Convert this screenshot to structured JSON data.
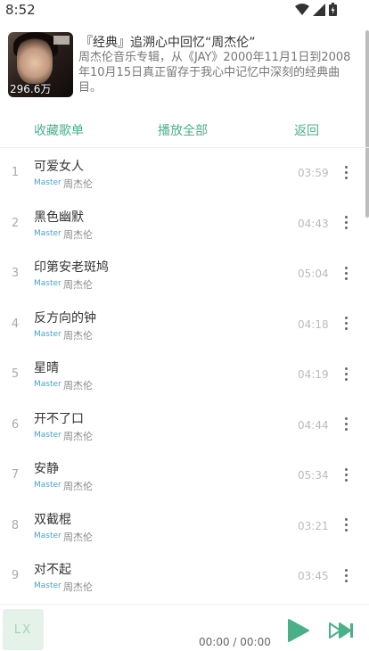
{
  "status_bar": {
    "time": "8:52"
  },
  "header": {
    "title": "『经典』追溯心中回忆“周杰伦”",
    "description": "周杰伦音乐专辑，从《JAY》2000年11月1日到2008年10月15日真正留存于我心中记忆中深刻的经典曲目。",
    "play_count": "296.6万"
  },
  "actions": {
    "favorite": "收藏歌单",
    "play_all": "播放全部",
    "back": "返回"
  },
  "songs": [
    {
      "index": "1",
      "name": "可爱女人",
      "quality": "Master",
      "artist": "周杰伦",
      "duration": "03:59"
    },
    {
      "index": "2",
      "name": "黑色幽默",
      "quality": "Master",
      "artist": "周杰伦",
      "duration": "04:43"
    },
    {
      "index": "3",
      "name": "印第安老斑鸠",
      "quality": "Master",
      "artist": "周杰伦",
      "duration": "05:04"
    },
    {
      "index": "4",
      "name": "反方向的钟",
      "quality": "Master",
      "artist": "周杰伦",
      "duration": "04:18"
    },
    {
      "index": "5",
      "name": "星晴",
      "quality": "Master",
      "artist": "周杰伦",
      "duration": "04:19"
    },
    {
      "index": "6",
      "name": "开不了口",
      "quality": "Master",
      "artist": "周杰伦",
      "duration": "04:44"
    },
    {
      "index": "7",
      "name": "安静",
      "quality": "Master",
      "artist": "周杰伦",
      "duration": "05:34"
    },
    {
      "index": "8",
      "name": "双截棍",
      "quality": "Master",
      "artist": "周杰伦",
      "duration": "03:21"
    },
    {
      "index": "9",
      "name": "对不起",
      "quality": "Master",
      "artist": "周杰伦",
      "duration": "03:45"
    }
  ],
  "player": {
    "art_label": "LX",
    "time": "00:00 / 00:00"
  },
  "colors": {
    "accent": "#4ab08a",
    "quality": "#4aa3c9"
  },
  "icons": {
    "play": "play-icon",
    "next": "next-icon",
    "more": "more-vertical-icon"
  }
}
